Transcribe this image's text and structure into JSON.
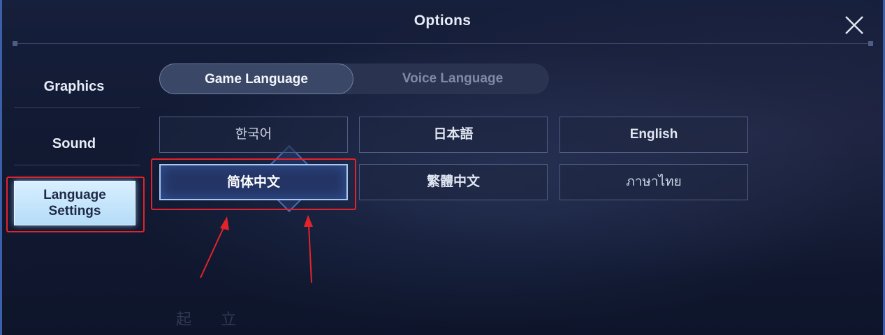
{
  "window": {
    "title": "Options"
  },
  "side_menu": {
    "items": [
      {
        "label": "Graphics"
      },
      {
        "label": "Sound"
      },
      {
        "label_line1": "Language",
        "label_line2": "Settings"
      }
    ],
    "active_index": 2
  },
  "tabs": [
    {
      "label": "Game Language",
      "active": true
    },
    {
      "label": "Voice Language",
      "active": false
    }
  ],
  "languages": [
    {
      "label": "한국어",
      "selected": false
    },
    {
      "label": "日本語",
      "selected": false
    },
    {
      "label": "English",
      "selected": false
    },
    {
      "label": "简体中文",
      "selected": true
    },
    {
      "label": "繁體中文",
      "selected": false
    },
    {
      "label": "ภาษาไทย",
      "selected": false
    }
  ],
  "background_text": "起 立",
  "colors": {
    "highlight_red": "#e3232b",
    "active_side_item": "#c6e6fb",
    "selected_language_border": "#a8c8ee"
  },
  "icons": [
    "close-icon"
  ]
}
